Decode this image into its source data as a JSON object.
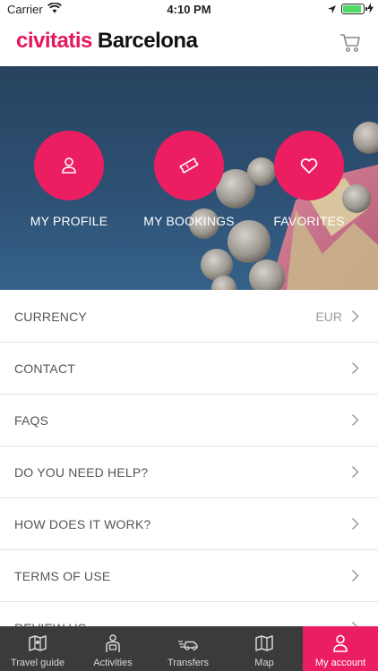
{
  "status_bar": {
    "carrier": "Carrier",
    "time": "4:10 PM"
  },
  "header": {
    "logo": "civitatis",
    "city": "Barcelona",
    "cart_icon": "shopping-cart-icon"
  },
  "quick_actions": [
    {
      "label": "MY PROFILE",
      "icon": "user-icon"
    },
    {
      "label": "MY BOOKINGS",
      "icon": "ticket-icon"
    },
    {
      "label": "FAVORITES",
      "icon": "heart-icon"
    }
  ],
  "menu": [
    {
      "label": "CURRENCY",
      "value": "EUR"
    },
    {
      "label": "CONTACT"
    },
    {
      "label": "FAQS"
    },
    {
      "label": "DO YOU NEED HELP?"
    },
    {
      "label": "HOW DOES IT WORK?"
    },
    {
      "label": "TERMS OF USE"
    },
    {
      "label": "REVIEW US"
    }
  ],
  "tabs": [
    {
      "label": "Travel guide",
      "icon": "map-book-icon"
    },
    {
      "label": "Activities",
      "icon": "guide-person-icon"
    },
    {
      "label": "Transfers",
      "icon": "car-icon"
    },
    {
      "label": "Map",
      "icon": "map-icon"
    },
    {
      "label": "My account",
      "icon": "user-icon",
      "active": true
    }
  ],
  "colors": {
    "accent": "#ec1e62",
    "tabbar": "#3b3b3b",
    "hero_bg": "#2d5073"
  }
}
